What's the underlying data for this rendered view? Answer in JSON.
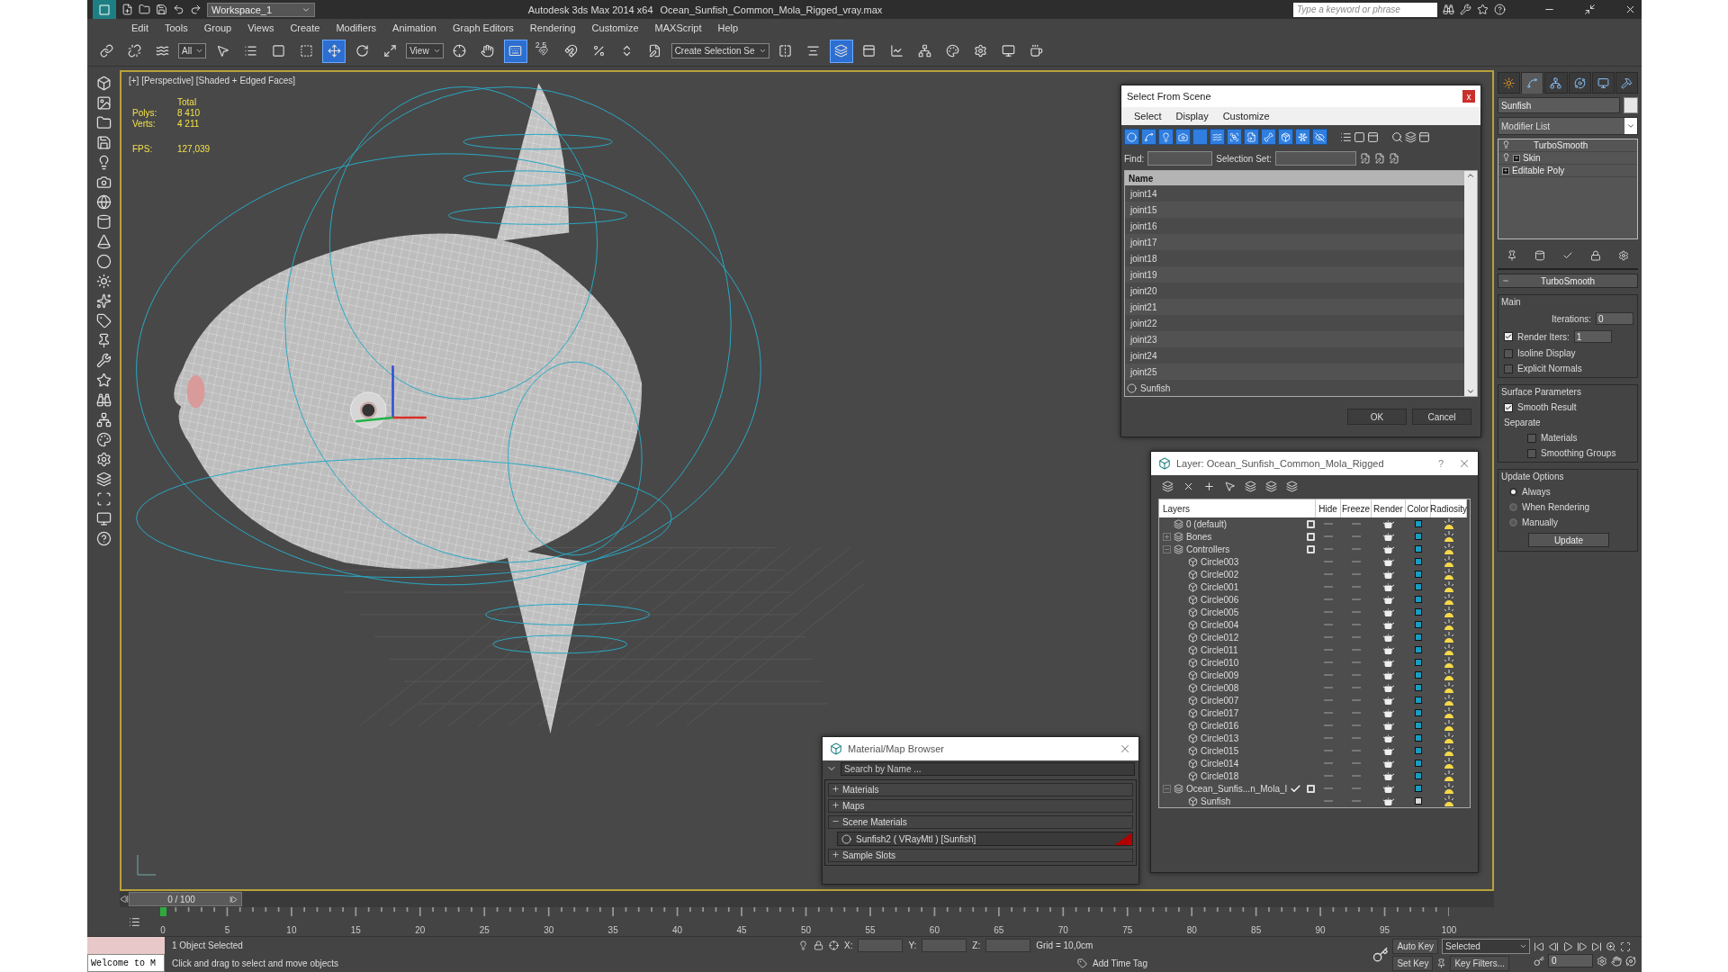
{
  "title_bar": {
    "workspace": "Workspace_1",
    "app": "Autodesk 3ds Max  2014 x64",
    "file": "Ocean_Sunfish_Common_Mola_Rigged_vray.max",
    "search_placeholder": "Type a keyword or phrase"
  },
  "menu": [
    "Edit",
    "Tools",
    "Group",
    "Views",
    "Create",
    "Modifiers",
    "Animation",
    "Graph Editors",
    "Rendering",
    "Customize",
    "MAXScript",
    "Help"
  ],
  "toolbar": [
    {
      "kind": "link",
      "selected": false
    },
    {
      "kind": "unlink",
      "selected": false
    },
    {
      "kind": "bind",
      "selected": false
    },
    {
      "kind": "dropdown",
      "value": "All"
    },
    {
      "kind": "select",
      "selected": false
    },
    {
      "kind": "select-by-name",
      "selected": false
    },
    {
      "kind": "region",
      "selected": false
    },
    {
      "kind": "crossing",
      "selected": false
    },
    {
      "kind": "move",
      "selected": true
    },
    {
      "kind": "rotate",
      "selected": false
    },
    {
      "kind": "scale",
      "selected": false
    },
    {
      "kind": "dropdown",
      "value": "View"
    },
    {
      "kind": "pivot",
      "selected": false
    },
    {
      "kind": "manipulate",
      "selected": false
    },
    {
      "kind": "keyboard",
      "selected": true
    },
    {
      "kind": "snap",
      "label": "2.5",
      "selected": false
    },
    {
      "kind": "angle-snap",
      "selected": false
    },
    {
      "kind": "percent-snap",
      "selected": false
    },
    {
      "kind": "spinner-snap",
      "selected": false
    },
    {
      "kind": "edit-named",
      "selected": false
    },
    {
      "kind": "dropdown",
      "value": "Create Selection Se"
    },
    {
      "kind": "mirror",
      "selected": false
    },
    {
      "kind": "align",
      "selected": false
    },
    {
      "kind": "layers",
      "selected": true
    },
    {
      "kind": "ribbon",
      "selected": false
    },
    {
      "kind": "curve-editor",
      "selected": false
    },
    {
      "kind": "schematic",
      "selected": false
    },
    {
      "kind": "material-editor",
      "selected": false
    },
    {
      "kind": "render-setup",
      "selected": false
    },
    {
      "kind": "frame-window",
      "selected": false
    },
    {
      "kind": "render",
      "selected": false
    }
  ],
  "viewport": {
    "label": "[+] [Perspective] [Shaded + Edged Faces]",
    "stats_heading": "Total",
    "stats": [
      {
        "label": "Polys:",
        "value": "8 410"
      },
      {
        "label": "Verts:",
        "value": "4 211"
      }
    ],
    "fps_label": "FPS:",
    "fps": "127,039"
  },
  "select_dialog": {
    "title": "Select From Scene",
    "close": "x",
    "menu": [
      "Select",
      "Display",
      "Customize"
    ],
    "filters": [
      {
        "kind": "geometry",
        "selected": true
      },
      {
        "kind": "shape",
        "selected": true
      },
      {
        "kind": "light",
        "selected": true
      },
      {
        "kind": "camera",
        "selected": true
      },
      {
        "kind": "helper",
        "selected": true
      },
      {
        "kind": "spacewarp",
        "selected": true
      },
      {
        "kind": "group",
        "selected": true
      },
      {
        "kind": "xref",
        "selected": true
      },
      {
        "kind": "bone",
        "selected": true
      },
      {
        "kind": "container",
        "selected": true
      },
      {
        "kind": "frozen",
        "selected": true
      },
      {
        "kind": "hidden",
        "selected": true
      }
    ],
    "find_label": "Find:",
    "selection_set_label": "Selection Set:",
    "column": "Name",
    "rows": [
      {
        "name": "joint14",
        "kind": "helper"
      },
      {
        "name": "joint15",
        "kind": "helper"
      },
      {
        "name": "joint16",
        "kind": "helper"
      },
      {
        "name": "joint17",
        "kind": "helper"
      },
      {
        "name": "joint18",
        "kind": "helper"
      },
      {
        "name": "joint19",
        "kind": "helper"
      },
      {
        "name": "joint20",
        "kind": "helper"
      },
      {
        "name": "joint21",
        "kind": "helper"
      },
      {
        "name": "joint22",
        "kind": "helper"
      },
      {
        "name": "joint23",
        "kind": "helper"
      },
      {
        "name": "joint24",
        "kind": "helper"
      },
      {
        "name": "joint25",
        "kind": "helper"
      },
      {
        "name": "Sunfish",
        "kind": "geometry"
      }
    ],
    "ok": "OK",
    "cancel": "Cancel"
  },
  "layer_dialog": {
    "title": "Layer: Ocean_Sunfish_Common_Mola_Rigged",
    "help": "?",
    "columns": [
      "Layers",
      "Hide",
      "Freeze",
      "Render",
      "Color",
      "Radiosity"
    ],
    "layers": [
      {
        "name": "0 (default)",
        "current": false,
        "color": "#1a9cc0"
      },
      {
        "name": "Bones",
        "current": false,
        "expanded": false,
        "color": "#1a9cc0"
      },
      {
        "name": "Controllers",
        "current": false,
        "expanded": true,
        "color": "#1a9cc0",
        "children": [
          {
            "name": "Circle003",
            "color": "#1a9cc0"
          },
          {
            "name": "Circle002",
            "color": "#1a9cc0"
          },
          {
            "name": "Circle001",
            "color": "#1a9cc0"
          },
          {
            "name": "Circle006",
            "color": "#1a9cc0"
          },
          {
            "name": "Circle005",
            "color": "#1a9cc0"
          },
          {
            "name": "Circle004",
            "color": "#1a9cc0"
          },
          {
            "name": "Circle012",
            "color": "#1a9cc0"
          },
          {
            "name": "Circle011",
            "color": "#1a9cc0"
          },
          {
            "name": "Circle010",
            "color": "#1a9cc0"
          },
          {
            "name": "Circle009",
            "color": "#1a9cc0"
          },
          {
            "name": "Circle008",
            "color": "#1a9cc0"
          },
          {
            "name": "Circle007",
            "color": "#1a9cc0"
          },
          {
            "name": "Circle017",
            "color": "#1a9cc0"
          },
          {
            "name": "Circle016",
            "color": "#1a9cc0"
          },
          {
            "name": "Circle013",
            "color": "#1a9cc0"
          },
          {
            "name": "Circle015",
            "color": "#1a9cc0"
          },
          {
            "name": "Circle014",
            "color": "#1a9cc0"
          },
          {
            "name": "Circle018",
            "color": "#1a9cc0"
          }
        ]
      },
      {
        "name": "Ocean_Sunfis...n_Mola_I",
        "current": true,
        "expanded": true,
        "color": "#1a9cc0",
        "children": [
          {
            "name": "Sunfish",
            "color": "#d8d8d8"
          }
        ]
      }
    ]
  },
  "material_browser": {
    "title": "Material/Map Browser",
    "search_placeholder": "Search by Name ...",
    "groups": [
      {
        "label": "Materials",
        "expanded": false
      },
      {
        "label": "Maps",
        "expanded": false
      },
      {
        "label": "Scene Materials",
        "expanded": true,
        "items": [
          {
            "name": "Sunfish2  ( VRayMtl ) [Sunfish]",
            "in_scene": true
          }
        ]
      },
      {
        "label": "Sample Slots",
        "expanded": false
      }
    ]
  },
  "command_panel": {
    "tabs": [
      {
        "kind": "create",
        "selected": false
      },
      {
        "kind": "modify",
        "selected": true
      },
      {
        "kind": "hierarchy",
        "selected": false
      },
      {
        "kind": "motion",
        "selected": false
      },
      {
        "kind": "display",
        "selected": false
      },
      {
        "kind": "utilities",
        "selected": false
      }
    ],
    "object_name": "Sunfish",
    "modifier_list": "Modifier List",
    "stack": [
      {
        "label": "TurboSmooth",
        "toggle": true,
        "expandable": false
      },
      {
        "label": "Skin",
        "toggle": true,
        "expandable": true
      },
      {
        "label": "Editable Poly",
        "toggle": false,
        "expandable": true
      }
    ],
    "rollout": {
      "title": "TurboSmooth",
      "main_title": "Main",
      "iterations_label": "Iterations:",
      "iterations": "0",
      "render_iters": {
        "label": "Render Iters:",
        "checked": true,
        "value": "1"
      },
      "main_options": [
        {
          "label": "Isoline Display",
          "checked": false
        },
        {
          "label": "Explicit Normals",
          "checked": false
        }
      ],
      "surface_title": "Surface Parameters",
      "smooth_result": {
        "label": "Smooth Result",
        "checked": true
      },
      "separate_label": "Separate",
      "separate": [
        {
          "label": "Materials",
          "checked": false
        },
        {
          "label": "Smoothing Groups",
          "checked": false
        }
      ],
      "update_title": "Update Options",
      "update_options": [
        {
          "label": "Always",
          "selected": true
        },
        {
          "label": "When Rendering",
          "selected": false
        },
        {
          "label": "Manually",
          "selected": false
        }
      ],
      "update_button": "Update"
    }
  },
  "timeline": {
    "frame": "0 / 100",
    "ticks": [
      "0",
      "5",
      "10",
      "15",
      "20",
      "25",
      "30",
      "35",
      "40",
      "45",
      "50",
      "55",
      "60",
      "65",
      "70",
      "75",
      "80",
      "85",
      "90",
      "95",
      "100"
    ]
  },
  "status_bar": {
    "script_listener": "Welcome to M",
    "selection": "1 Object Selected",
    "prompt": "Click and drag to select and move objects",
    "x_label": "X:",
    "y_label": "Y:",
    "z_label": "Z:",
    "grid": "Grid = 10,0cm",
    "add_time_tag": "Add Time Tag",
    "auto_key": "Auto Key",
    "key_mode": "Selected",
    "set_key": "Set Key",
    "key_filters": "Key Filters...",
    "frame": "0"
  }
}
